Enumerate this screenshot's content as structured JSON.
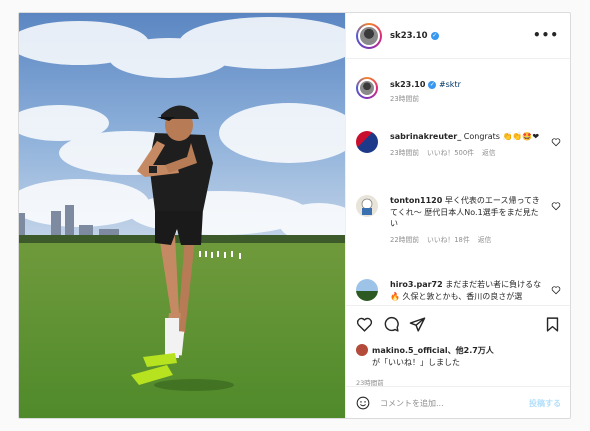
{
  "post": {
    "username": "sk23.10",
    "more_label": "•••"
  },
  "caption": {
    "username": "sk23.10",
    "text": "#sktr",
    "time": "23時間前"
  },
  "comments": [
    {
      "username": "sabrinakreuter_",
      "text": "Congrats 👏👏🤩❤",
      "time": "23時間前",
      "likes": "いいね！500件",
      "reply": "返信"
    },
    {
      "username": "tonton1120",
      "text": "早く代表のエース帰ってきてくれ〜 歴代日本人No.1選手をまだ見たい",
      "time": "22時間前",
      "likes": "いいね！18件",
      "reply": "返信"
    },
    {
      "username": "hiro3.par72",
      "text": "まだまだ若い者に負けるな🔥 久保と敦とかも、香川の良さが選",
      "time": "",
      "likes": "",
      "reply": ""
    }
  ],
  "likes": {
    "line1": "makino.5_official、他2.7万人",
    "line2": "が「いいね！」しました"
  },
  "time_ago": "23時間前",
  "comment_box": {
    "placeholder": "コメントを追加...",
    "post_label": "投稿する"
  },
  "colors": {
    "verified": "#3897f0",
    "link": "#00376b",
    "muted": "#8e8e8e",
    "post_disabled": "#b2dffc"
  },
  "icons": [
    "heart-icon",
    "comment-icon",
    "share-icon",
    "bookmark-icon",
    "emoji-icon",
    "verified-badge-icon",
    "more-options-icon"
  ]
}
